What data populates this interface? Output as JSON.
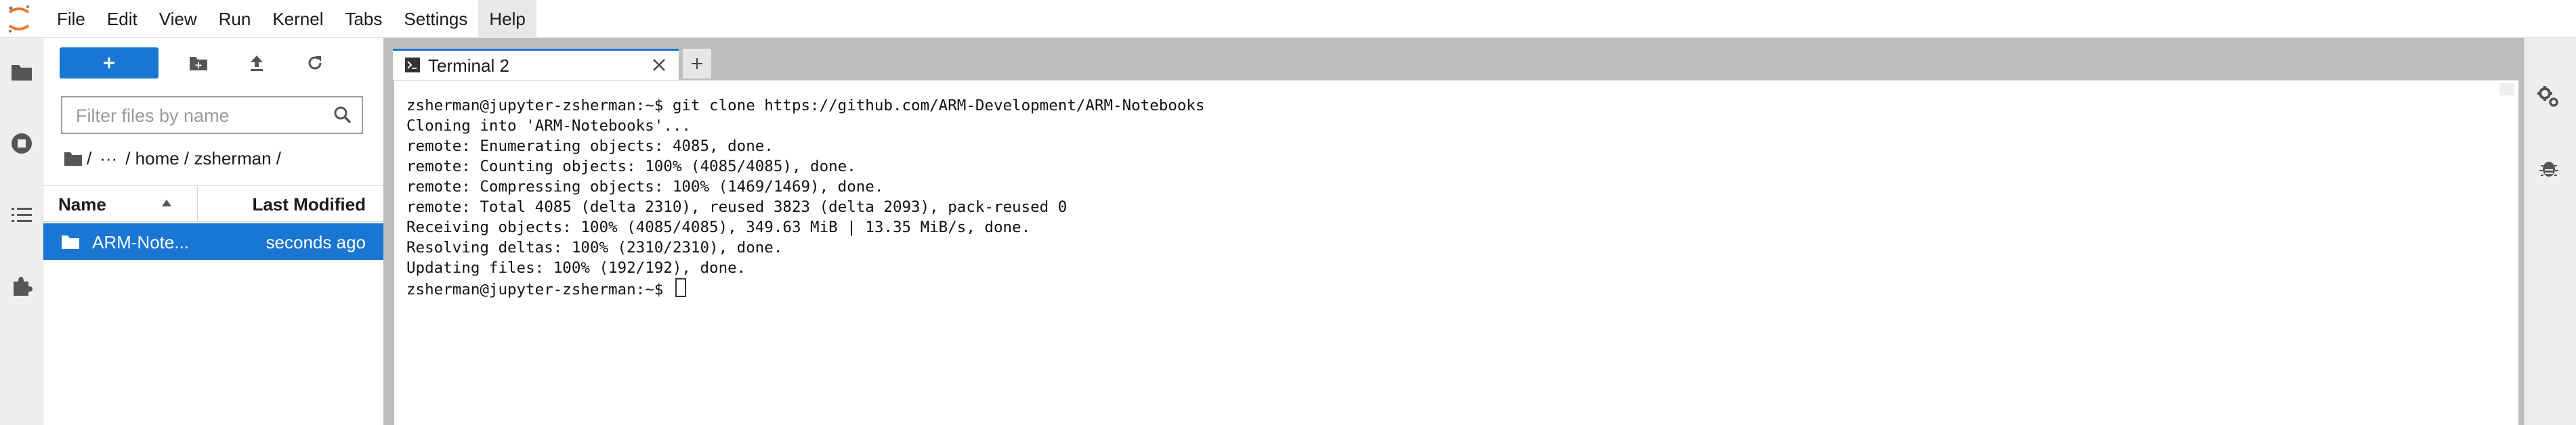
{
  "menubar": {
    "logo_icon": "jupyter-logo",
    "items": [
      {
        "label": "File"
      },
      {
        "label": "Edit"
      },
      {
        "label": "View"
      },
      {
        "label": "Run"
      },
      {
        "label": "Kernel"
      },
      {
        "label": "Tabs"
      },
      {
        "label": "Settings"
      },
      {
        "label": "Help"
      }
    ]
  },
  "left_sidebar": {
    "icons": [
      "folder-icon",
      "running-icon",
      "toc-icon",
      "extension-icon"
    ]
  },
  "filebrowser": {
    "new_button_label": "+",
    "toolbar_icons": [
      "new-folder-icon",
      "upload-icon",
      "refresh-icon"
    ],
    "filter_placeholder": "Filter files by name",
    "filter_value": "",
    "breadcrumbs": {
      "root": "/",
      "ellipsis": "···",
      "path": "/ home / zsherman /"
    },
    "columns": {
      "name": "Name",
      "modified": "Last Modified"
    },
    "items": [
      {
        "name": "ARM-Note...",
        "modified": "seconds ago",
        "selected": true
      }
    ]
  },
  "tabs": [
    {
      "label": "Terminal 2",
      "active": true
    }
  ],
  "terminal": {
    "lines": [
      "zsherman@jupyter-zsherman:~$ git clone https://github.com/ARM-Development/ARM-Notebooks",
      "Cloning into 'ARM-Notebooks'...",
      "remote: Enumerating objects: 4085, done.",
      "remote: Counting objects: 100% (4085/4085), done.",
      "remote: Compressing objects: 100% (1469/1469), done.",
      "remote: Total 4085 (delta 2310), reused 3823 (delta 2093), pack-reused 0",
      "Receiving objects: 100% (4085/4085), 349.63 MiB | 13.35 MiB/s, done.",
      "Resolving deltas: 100% (2310/2310), done.",
      "Updating files: 100% (192/192), done."
    ],
    "prompt": "zsherman@jupyter-zsherman:~$ "
  },
  "right_sidebar": {
    "icons": [
      "property-inspector-icon",
      "debugger-icon"
    ]
  },
  "colors": {
    "accent": "#1976d2",
    "sidebar_bg": "#eeeeee",
    "dock_bg": "#bdbdbd"
  }
}
